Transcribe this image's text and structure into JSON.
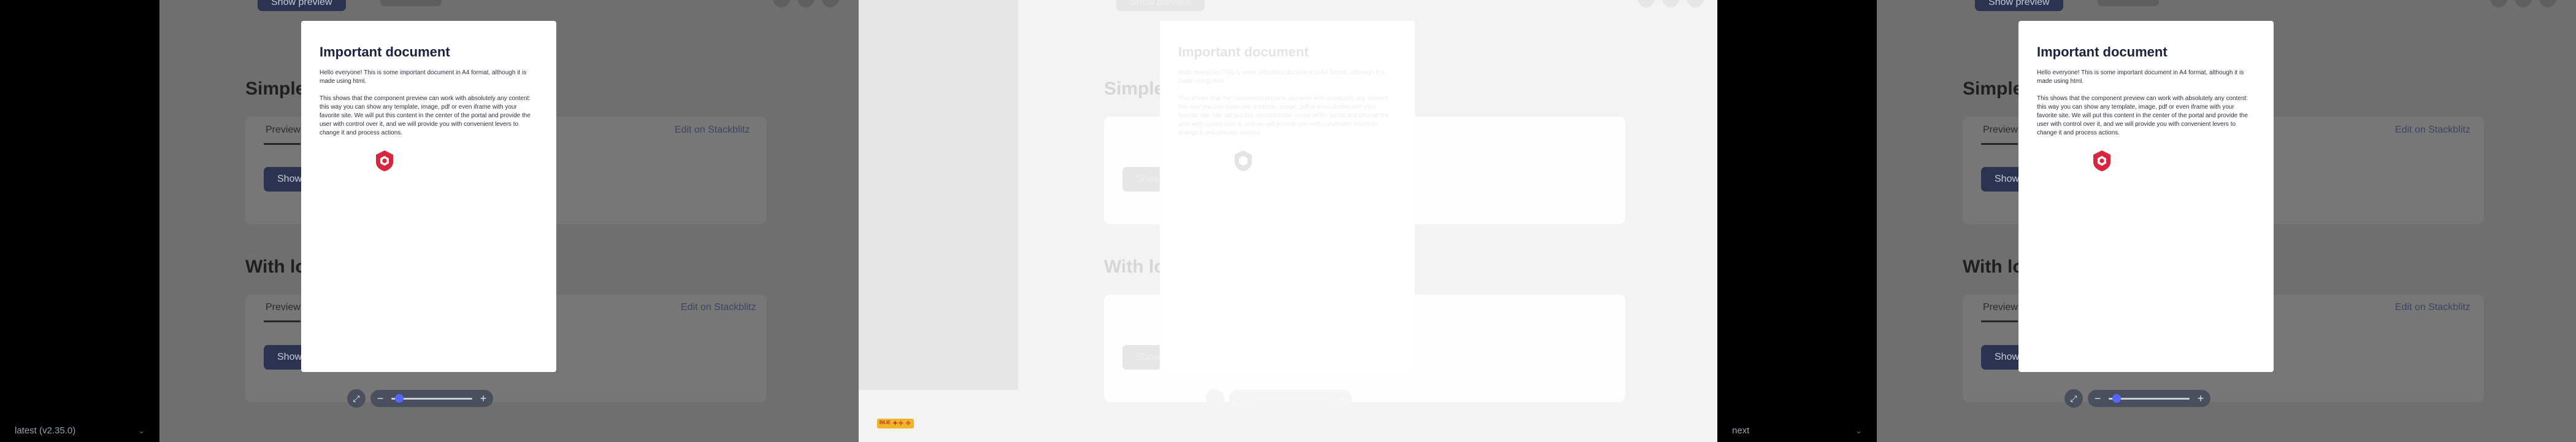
{
  "panels": [
    {
      "id": "frame-1",
      "env_label": "latest (v2.35.0)",
      "sections": [
        {
          "title": "Simple i",
          "tab": "Preview",
          "link": "Edit on Stackblitz",
          "button": "Show"
        },
        {
          "title": "With loa",
          "tab": "Preview",
          "link": "Edit on Stackblitz",
          "button": "Show"
        }
      ],
      "top_button": "Show preview"
    },
    {
      "id": "frame-2",
      "env_label": "",
      "badge": "ᴮᴵᴸᴵᴱ ✦✧ ✧",
      "sections": [
        {
          "title": "Simple i",
          "tab": "Preview",
          "link": "Edit on Stackblitz",
          "button": "Show"
        },
        {
          "title": "With lo",
          "tab": "Preview",
          "link": "Edit on Stackblitz",
          "button": "Show"
        }
      ],
      "top_button": "Show preview"
    },
    {
      "id": "frame-3",
      "env_label": "next",
      "sections": [
        {
          "title": "Simple i",
          "tab": "Preview",
          "link": "Edit on Stackblitz",
          "button": "Show"
        },
        {
          "title": "With loa",
          "tab": "Preview",
          "link": "Edit on Stackblitz",
          "button": "Show"
        }
      ],
      "top_button": "Show preview"
    }
  ],
  "modal": {
    "title": "Important document",
    "paragraph1": "Hello everyone! This is some important document in A4 format, although it is made using html.",
    "paragraph2": "This shows that the component preview can work with absolutely any content: this way you can show any template, image, pdf or even iframe with your favorite site. We will put this content in the center of the portal and provide the user with control over it, and we will provide you with convenient levers to change it and process actions."
  },
  "zoom": {
    "minus": "−",
    "plus": "+",
    "toggle": "⤢",
    "level": 0.06
  },
  "icons": {
    "logo": "taiga-shield-icon",
    "accent": "#d7263d"
  }
}
